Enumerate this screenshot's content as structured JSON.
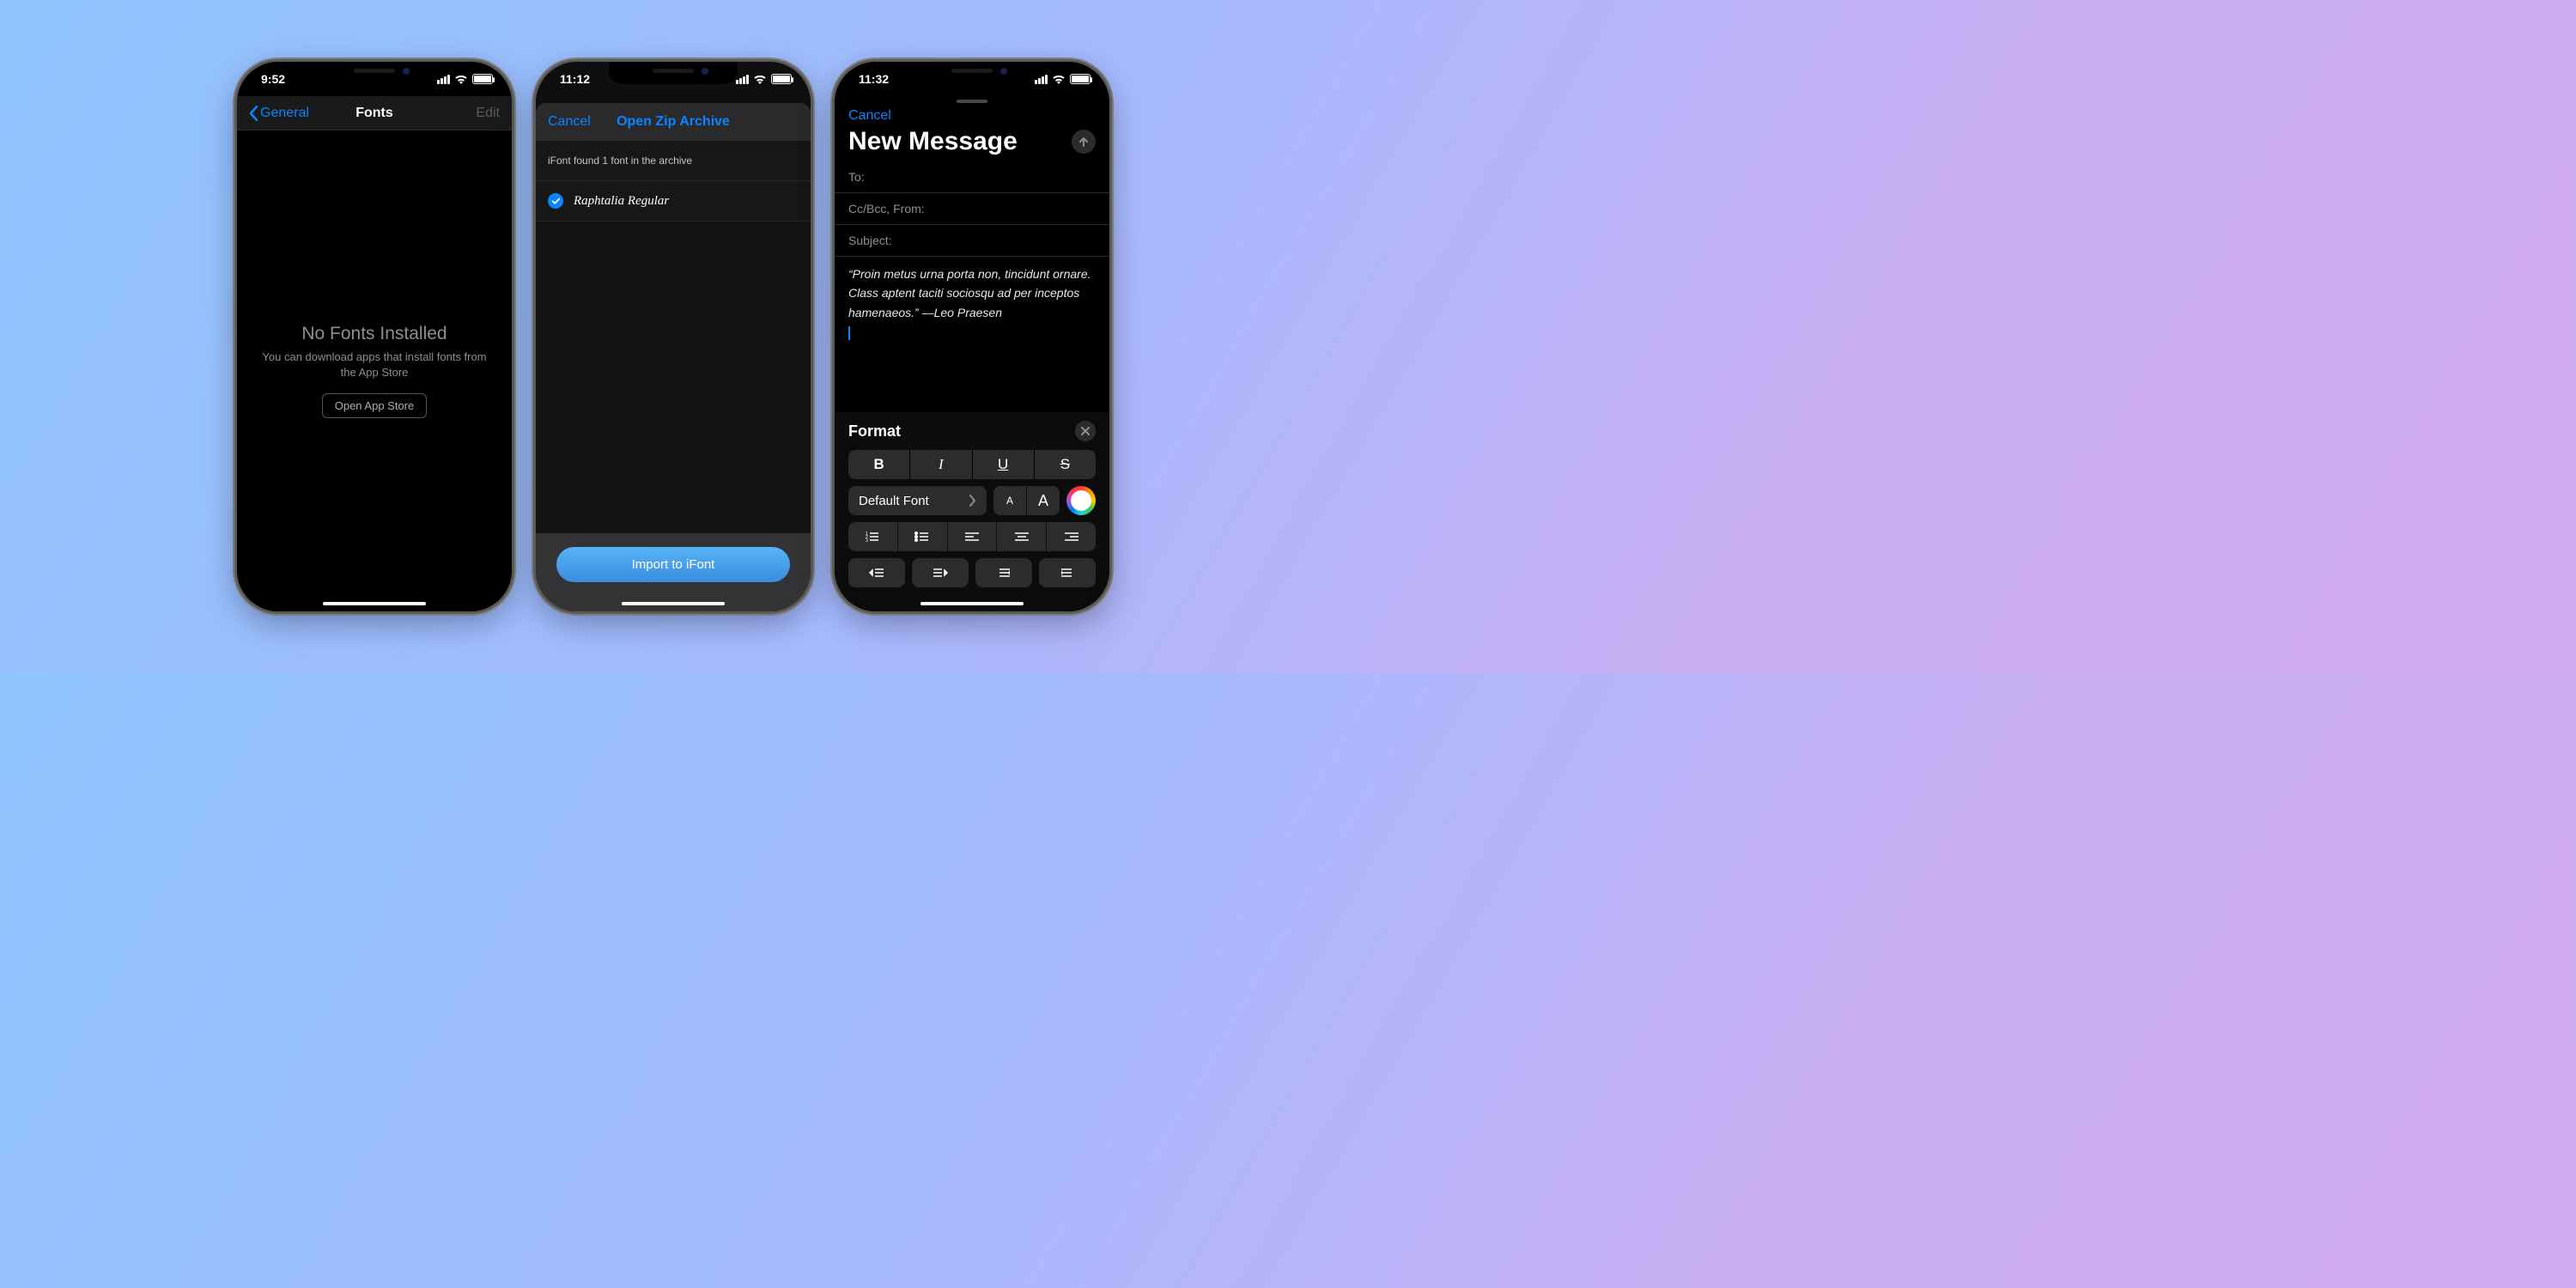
{
  "phone1": {
    "status_time": "9:52",
    "nav_back": "General",
    "nav_title": "Fonts",
    "nav_edit": "Edit",
    "empty_title": "No Fonts Installed",
    "empty_sub": "You can download apps that install fonts from the App Store",
    "open_btn": "Open App Store"
  },
  "phone2": {
    "status_time": "11:12",
    "cancel": "Cancel",
    "title": "Open Zip Archive",
    "info": "iFont found 1 font in the archive",
    "fontname": "Raphtalia Regular",
    "import_btn": "Import to iFont"
  },
  "phone3": {
    "status_time": "11:32",
    "cancel": "Cancel",
    "title": "New Message",
    "to_label": "To:",
    "cc_label": "Cc/Bcc, From:",
    "subject_label": "Subject:",
    "body_text": "“Proin metus urna porta non, tincidunt ornare. Class aptent taciti sociosqu ad per inceptos hamenaeos.” —Leo Praesen",
    "format_label": "Format",
    "default_font": "Default Font"
  }
}
